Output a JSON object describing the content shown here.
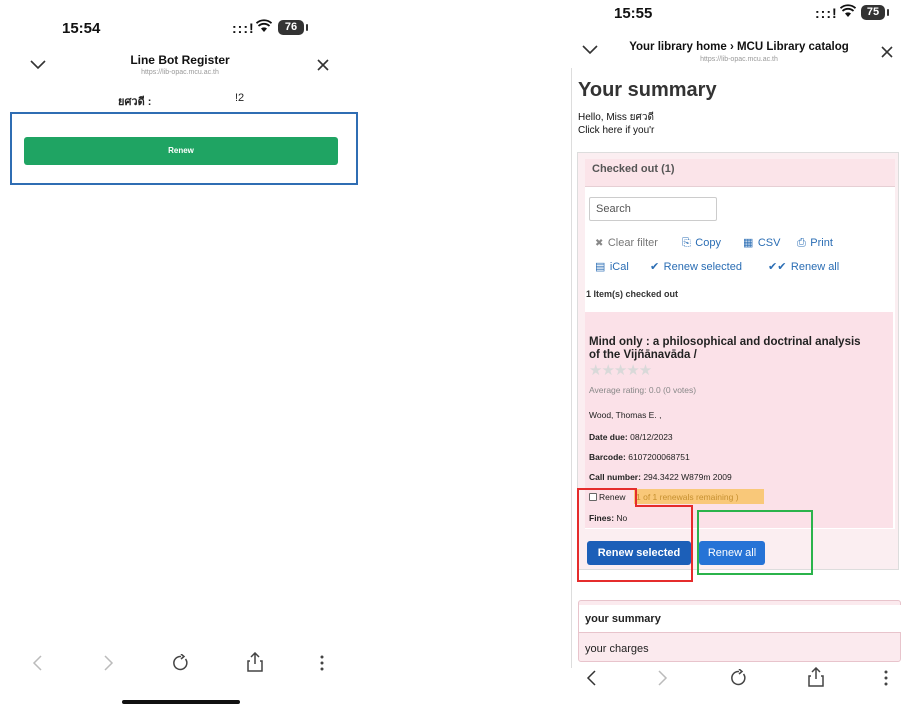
{
  "left": {
    "status": {
      "time": "15:54",
      "signal": ":::!",
      "battery": "76"
    },
    "header": {
      "title": "Line Bot Register",
      "url": "https://lib-opac.mcu.ac.th"
    },
    "user_row": {
      "name": "ยศวดี :",
      "suffix": "!2"
    },
    "renew_button": "Renew"
  },
  "right": {
    "status": {
      "time": "15:55",
      "signal": ":::!",
      "battery": "75"
    },
    "header": {
      "title": "Your library home › MCU Library catalog",
      "url": "https://lib-opac.mcu.ac.th"
    },
    "summary_title": "Your summary",
    "hello": "Hello, Miss ยศวดี",
    "click_here": "Click here if you'r",
    "checked_out_tab": "Checked out (1)",
    "search_placeholder": "Search",
    "toolbar": {
      "clear_filter": "Clear filter",
      "copy": "Copy",
      "csv": "CSV",
      "print": "Print",
      "ical": "iCal",
      "renew_selected": "Renew selected",
      "renew_all": "Renew all"
    },
    "items_count": "1 Item(s) checked out",
    "item": {
      "title_line1": "Mind only : a philosophical and doctrinal analysis",
      "title_line2": "of the Vijñānavāda /",
      "rating_text": "Average rating: 0.0 (0 votes)",
      "author": "Wood, Thomas E. ,",
      "date_due_label": "Date due:",
      "date_due": "08/12/2023",
      "barcode_label": "Barcode:",
      "barcode": "6107200068751",
      "call_number_label": "Call number:",
      "call_number": "294.3422 W879m 2009",
      "renew_label": "Renew",
      "renewals_remaining": "1 of 1 renewals remaining )",
      "fines_label": "Fines:",
      "fines": "No"
    },
    "buttons": {
      "renew_selected": "Renew selected",
      "renew_all": "Renew all"
    },
    "menu": {
      "summary": "your summary",
      "charges": "your charges"
    }
  }
}
